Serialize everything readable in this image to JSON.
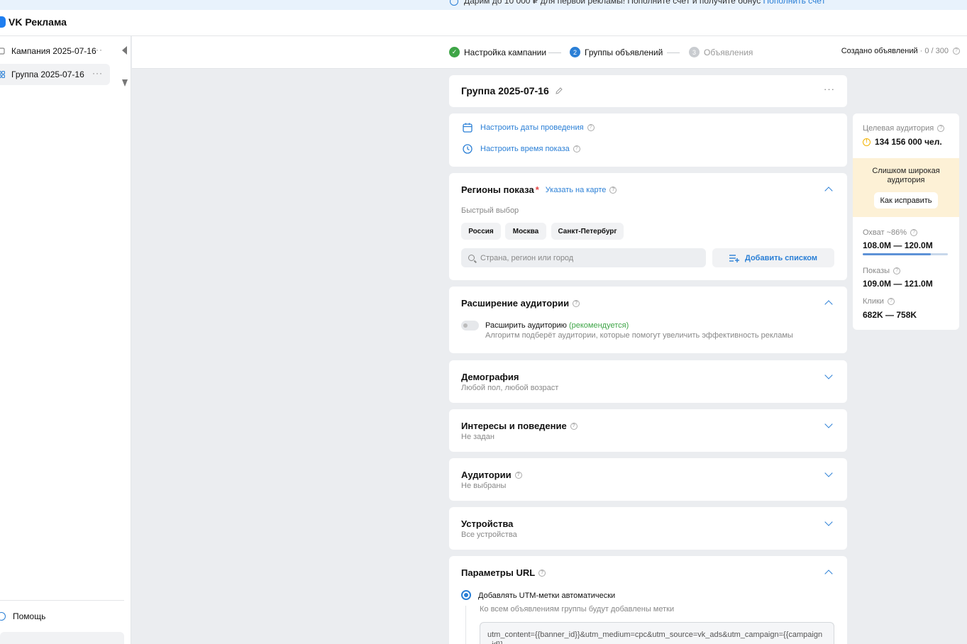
{
  "banner": {
    "text": "Дарим до 10 000 ₽ для первой рекламы! Пополните счёт и получите бонус",
    "link": "Пополнить счёт"
  },
  "app": {
    "brand": "VK Реклама"
  },
  "sidebar": {
    "items": [
      {
        "label": "Кампания 2025-07-16",
        "more": "···"
      },
      {
        "label": "Группа 2025-07-16",
        "more": "···"
      }
    ],
    "help": "Помощь"
  },
  "steps": [
    {
      "number": "✓",
      "label": "Настройка кампании",
      "state": "done",
      "color": "#3ea547"
    },
    {
      "number": "2",
      "label": "Группы объявлений",
      "state": "active",
      "color": "#2a7fd6"
    },
    {
      "number": "3",
      "label": "Объявления",
      "state": "inactive",
      "color": "#c9ccd0"
    }
  ],
  "created": {
    "label": "Создано объявлений",
    "count": "· 0 / 300"
  },
  "group": {
    "title": "Группа 2025-07-16",
    "more": "···"
  },
  "schedule": {
    "dates_link": "Настроить даты проведения",
    "time_link": "Настроить время показа"
  },
  "regions": {
    "title": "Регионы показа",
    "required": "*",
    "map_link": "Указать на карте",
    "quick_label": "Быстрый выбор",
    "chips": [
      "Россия",
      "Москва",
      "Санкт-Петербург"
    ],
    "search_placeholder": "Страна, регион или город",
    "add_list": "Добавить списком"
  },
  "expansion": {
    "title": "Расширение аудитории",
    "toggle_label": "Расширить аудиторию",
    "recommended": "(рекомендуется)",
    "description": "Алгоритм подберёт аудитории, которые помогут увеличить эффективность рекламы"
  },
  "sections": [
    {
      "title": "Демография",
      "subtitle": "Любой пол, любой возраст"
    },
    {
      "title": "Интересы и поведение",
      "subtitle": "Не задан"
    },
    {
      "title": "Аудитории",
      "subtitle": "Не выбраны"
    },
    {
      "title": "Устройства",
      "subtitle": "Все устройства"
    }
  ],
  "url_params": {
    "title": "Параметры URL",
    "radio_label": "Добавлять UTM-метки автоматически",
    "description": "Ко всем объявлениям группы будут добавлены метки",
    "utm": "utm_content={{banner_id}}&utm_medium=cpc&utm_source=vk_ads&utm_campaign={{campaign_id}}"
  },
  "stats": {
    "audience_label": "Целевая аудитория",
    "audience_value": "134 156 000 чел.",
    "warning": "Слишком широкая аудитория",
    "fix_button": "Как исправить",
    "reach_label": "Охват ~86%",
    "reach_value": "108.0M — 120.0M",
    "reach_fraction": 0.8,
    "impressions_label": "Показы",
    "impressions_value": "109.0M — 121.0M",
    "clicks_label": "Клики",
    "clicks_value": "682K — 758K"
  },
  "colors": {
    "accent": "#2a7fd6",
    "success": "#3ea547",
    "warning": "#f2b300"
  }
}
